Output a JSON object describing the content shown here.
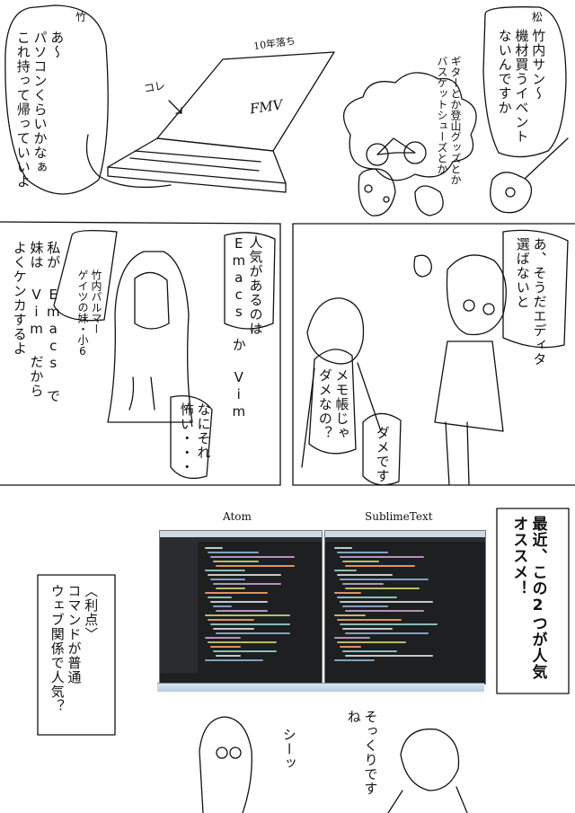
{
  "panel1": {
    "label_take": "竹",
    "label_matsu": "松",
    "bubble_take": "あ〜\nパソコンくらいかなぁ\nこれ持って帰っていいよ",
    "note_10years": "10年落ち",
    "note_kore": "コレ",
    "laptop_brand": "FMV",
    "bubble_matsu": "竹内サン〜\n機材買うイベント\nないんですか",
    "thought_items": "ギターとか登山グッズとか\nバスケットシューズとか"
  },
  "panel2": {
    "caption": "竹内パルマー\nゲイツの妹・小6",
    "bubble_popular": "人気があるのは\nEmacs か Vim",
    "bubble_sister": "私が Emacs で\n妹は Vim だから\nよくケンカするよ",
    "bubble_scary": "なにそれ\n怖い・・・"
  },
  "panel3": {
    "bubble_editor": "あ、そうだエディタ\n選ばないと",
    "bubble_memo": "メモ帳じゃ\nダメなの？",
    "bubble_dame": "ダメです"
  },
  "panel4": {
    "label_atom": "Atom",
    "label_sublime": "SublimeText",
    "box_recommend": "最近、この2つが人気\nオススメ！",
    "box_merits": "〈利点〉\nコマンドが普通\nウェブ関係で人気？",
    "bubble_shh": "シーッ",
    "bubble_similar": "そっくりですね"
  }
}
